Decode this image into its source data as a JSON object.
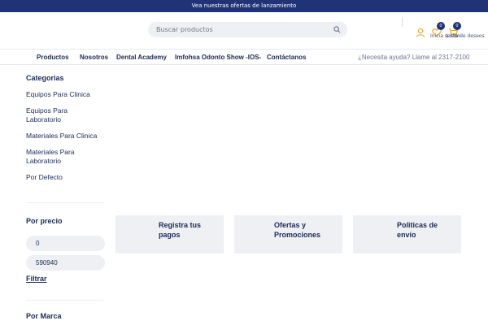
{
  "topbar": {
    "text": "Vea nuestras ofertas de lanzamiento"
  },
  "header": {
    "search_placeholder": "Buscar productos",
    "wishlist_count": "0",
    "cart_count": "0",
    "login_label": "Inicia sesión",
    "wishlist_label": "Lista de deseos",
    "accent_color": "#f0a020",
    "brand_color": "#1f3376"
  },
  "nav": {
    "items": [
      "Productos",
      "Nosotros",
      "Dental Academy",
      "Imfohsa Odonto Show -IOS-",
      "Contáctanos"
    ],
    "help": "¿Necesita ayuda? Llame al 2317-2100"
  },
  "sidebar": {
    "categories_title": "Categorias",
    "categories": [
      "Equipos Para Clinica",
      "Equipos Para Laboratorio",
      "Materiales Para Clinica",
      "Materiales Para Laboratorio",
      "Por Defecto"
    ],
    "price_title": "Por precio",
    "price_min": "0",
    "price_max": "590940",
    "filter_label": "Filtrar",
    "brand_title": "Por Marca"
  },
  "cards": [
    "Registra tus pagos",
    "Ofertas y Promociones",
    "Politicas de envío"
  ]
}
